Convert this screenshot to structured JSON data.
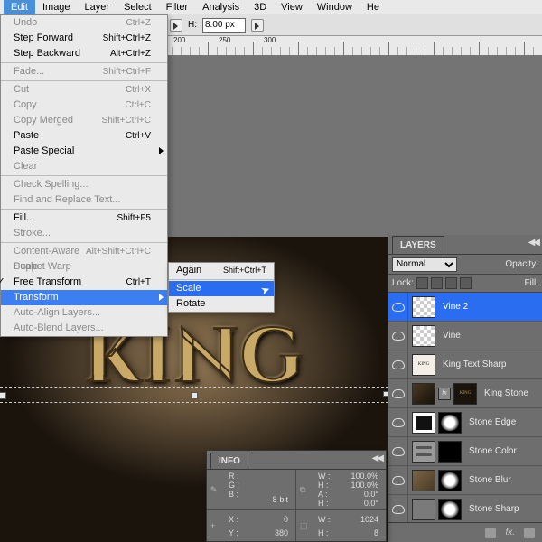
{
  "menubar": {
    "items": [
      "Edit",
      "Image",
      "Layer",
      "Select",
      "Filter",
      "Analysis",
      "3D",
      "View",
      "Window",
      "He"
    ],
    "active_index": 0
  },
  "optionsbar": {
    "height_label": "H:",
    "height_value": "8.00 px"
  },
  "ruler_ticks": [
    "200",
    "250",
    "300"
  ],
  "edit_menu": {
    "items": [
      {
        "label": "Undo",
        "short": "Ctrl+Z",
        "dis": true
      },
      {
        "label": "Step Forward",
        "short": "Shift+Ctrl+Z"
      },
      {
        "label": "Step Backward",
        "short": "Alt+Ctrl+Z"
      },
      {
        "sep": true
      },
      {
        "label": "Fade...",
        "short": "Shift+Ctrl+F",
        "dis": true
      },
      {
        "sep": true
      },
      {
        "label": "Cut",
        "short": "Ctrl+X",
        "dis": true
      },
      {
        "label": "Copy",
        "short": "Ctrl+C",
        "dis": true
      },
      {
        "label": "Copy Merged",
        "short": "Shift+Ctrl+C",
        "dis": true
      },
      {
        "label": "Paste",
        "short": "Ctrl+V"
      },
      {
        "label": "Paste Special",
        "arrow": true
      },
      {
        "label": "Clear",
        "dis": true
      },
      {
        "sep": true
      },
      {
        "label": "Check Spelling...",
        "dis": true
      },
      {
        "label": "Find and Replace Text...",
        "dis": true
      },
      {
        "sep": true
      },
      {
        "label": "Fill...",
        "short": "Shift+F5"
      },
      {
        "label": "Stroke...",
        "dis": true
      },
      {
        "sep": true
      },
      {
        "label": "Content-Aware Scale",
        "short": "Alt+Shift+Ctrl+C",
        "dis": true
      },
      {
        "label": "Puppet Warp",
        "dis": true
      },
      {
        "label": "Free Transform",
        "short": "Ctrl+T",
        "check": true
      },
      {
        "label": "Transform",
        "arrow": true,
        "hl": true
      },
      {
        "label": "Auto-Align Layers...",
        "dis": true
      },
      {
        "label": "Auto-Blend Layers...",
        "dis": true
      }
    ]
  },
  "transform_submenu": {
    "items": [
      {
        "label": "Again",
        "short": "Shift+Ctrl+T"
      },
      {
        "sep": true
      },
      {
        "label": "Scale",
        "hl": true
      },
      {
        "label": "Rotate"
      }
    ]
  },
  "canvas_text": "KING",
  "layers_panel": {
    "tab": "LAYERS",
    "blend_mode": "Normal",
    "opacity_label": "Opacity:",
    "lock_label": "Lock:",
    "fill_label": "Fill:",
    "layers": [
      {
        "name": "Vine 2",
        "sel": true,
        "thumbs": [
          "trans"
        ]
      },
      {
        "name": "Vine",
        "thumbs": [
          "trans"
        ]
      },
      {
        "name": "King Text Sharp",
        "thumbs": [
          "kingw"
        ]
      },
      {
        "name": "King Stone",
        "thumbs": [
          "stone",
          "fx",
          "kingt"
        ]
      },
      {
        "name": "Stone Edge",
        "thumbs": [
          "stoneedge",
          "mask white"
        ]
      },
      {
        "name": "Stone Color",
        "thumbs": [
          "adj",
          "mask"
        ]
      },
      {
        "name": "Stone Blur",
        "thumbs": [
          "stone2",
          "mask white"
        ]
      },
      {
        "name": "Stone Sharp",
        "thumbs": [
          "gray",
          "mask white"
        ]
      }
    ],
    "bottom_fx": "fx."
  },
  "info_panel": {
    "tab": "INFO",
    "rgb": {
      "R": "",
      "G": "",
      "B": ""
    },
    "bit": "8-bit",
    "dims": {
      "W": "100.0%",
      "H": "100.0%",
      "A": "0.0°",
      "H2": "0.0°"
    },
    "pos": {
      "X": "0",
      "Y": "380"
    },
    "size": {
      "W": "1024",
      "H": "8"
    }
  }
}
